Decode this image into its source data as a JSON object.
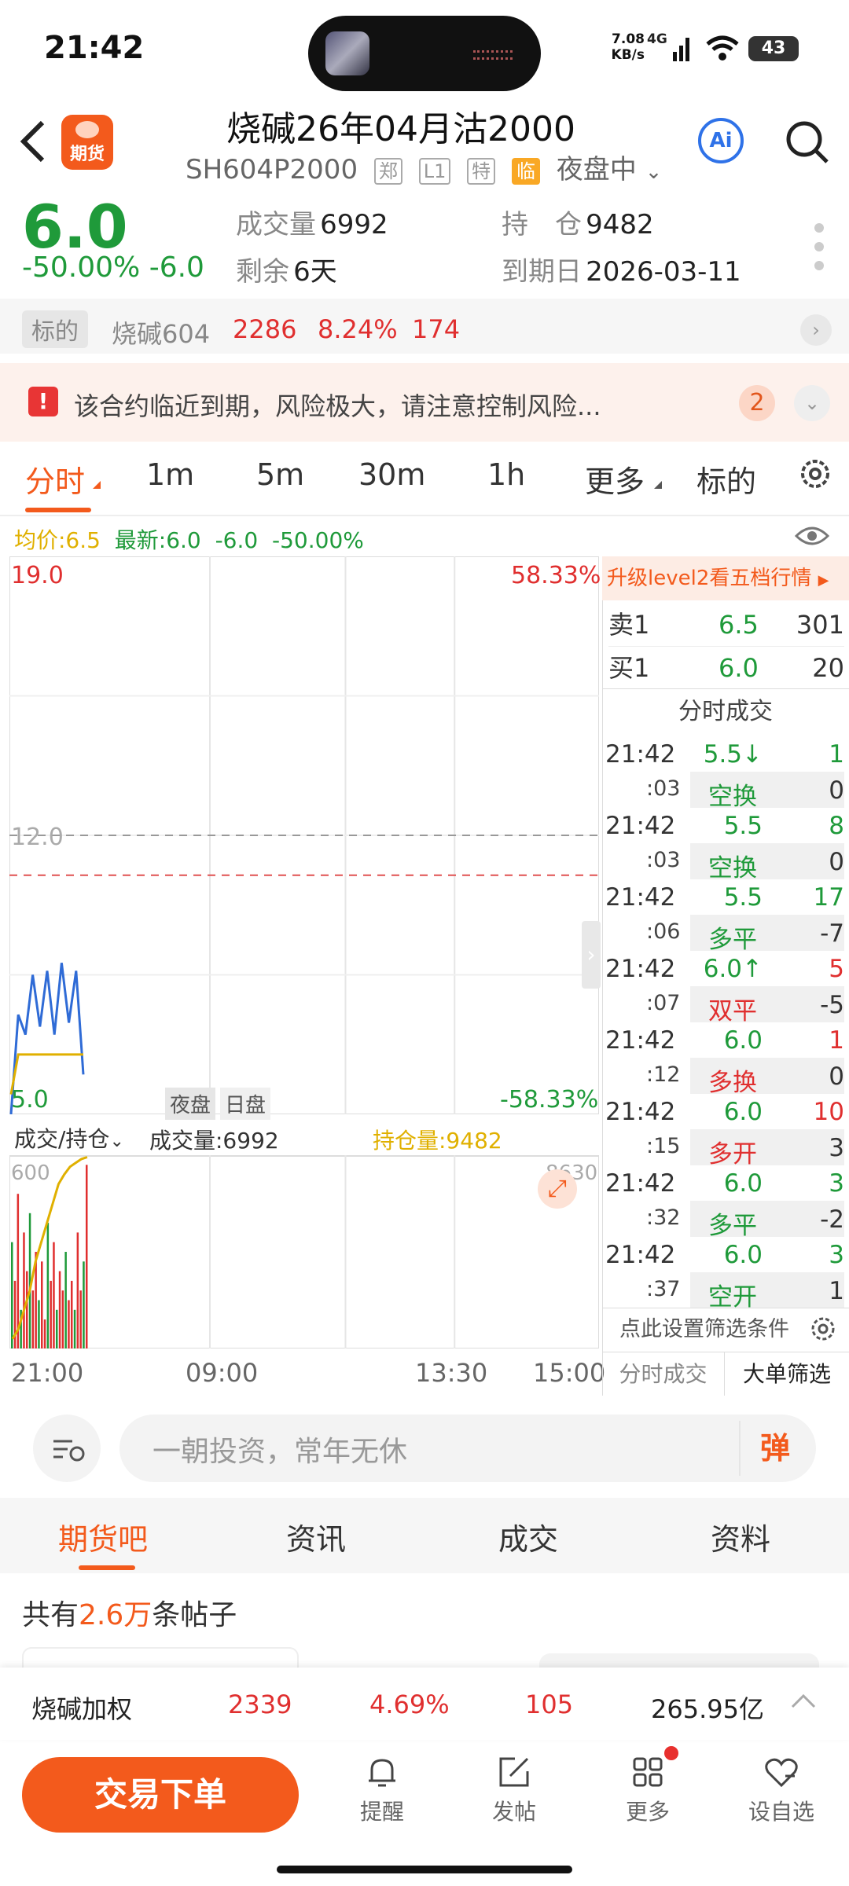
{
  "status": {
    "time": "21:42",
    "speed": "7.08 KB/s",
    "net": "4G",
    "battery": "43"
  },
  "header": {
    "title": "烧碱26年04月沽2000",
    "code": "SH604P2000",
    "tags": [
      "郑",
      "L1",
      "特"
    ],
    "tag_orange": "临",
    "session": "夜盘中",
    "ai_label": "Ai"
  },
  "quote": {
    "price": "6.0",
    "change": "-50.00% -6.0",
    "volume_label": "成交量",
    "volume": "6992",
    "remain_label": "剩余",
    "remain": "6天",
    "oi_label": "持　仓",
    "oi": "9482",
    "expiry_label": "到期日",
    "expiry": "2026-03-11"
  },
  "underlying": {
    "tag": "标的",
    "name": "烧碱604",
    "price": "2286",
    "pct": "8.24%",
    "change": "174"
  },
  "risk": {
    "icon": "!",
    "text": "该合约临近到期，风险极大，请注意控制风险...",
    "count": "2"
  },
  "period_tabs": [
    "分时",
    "1m",
    "5m",
    "30m",
    "1h",
    "更多",
    "标的"
  ],
  "legend": {
    "avg": "均价:6.5",
    "last": "最新:6.0",
    "chg": "-6.0",
    "pct": "-50.00%"
  },
  "chart": {
    "high": "19.0",
    "high_pct": "58.33%",
    "mid": "12.0",
    "low": "5.0",
    "low_pct": "-58.33%",
    "night": "夜盘",
    "day": "日盘",
    "vol_selector": "成交/持仓",
    "vol_text": "成交量:6992",
    "oi_text": "持仓量:9482",
    "vol_max": "600",
    "oi_max": "8630",
    "times": [
      "21:00",
      "09:00",
      "13:30",
      "15:00"
    ]
  },
  "chart_data": {
    "type": "line",
    "title": "",
    "ylim": [
      5.0,
      19.0
    ],
    "reference_price": 12.0,
    "series": [
      {
        "name": "最新",
        "values": [
          5.0,
          7.5,
          7.0,
          8.5,
          7.2,
          8.6,
          7.0,
          8.8,
          7.3,
          8.6,
          6.0
        ]
      },
      {
        "name": "均价",
        "values": [
          5.5,
          6.5,
          6.5,
          6.5,
          6.5,
          6.5,
          6.5,
          6.5,
          6.5,
          6.5,
          6.5
        ]
      }
    ],
    "volume_max": 600,
    "oi_max": 8630
  },
  "orderbook": {
    "upgrade": "升级level2看五档行情",
    "ask_label": "卖1",
    "ask_price": "6.5",
    "ask_qty": "301",
    "bid_label": "买1",
    "bid_price": "6.0",
    "bid_qty": "20",
    "ticks_title": "分时成交"
  },
  "ticks": [
    {
      "time": "21:42",
      "price": "5.5↓",
      "qty": "1",
      "sec": ":03",
      "type": "空换",
      "oi": "0",
      "pc": "green",
      "qc": "green",
      "tc": "green"
    },
    {
      "time": "21:42",
      "price": "5.5",
      "qty": "8",
      "sec": ":03",
      "type": "空换",
      "oi": "0",
      "pc": "green",
      "qc": "green",
      "tc": "green"
    },
    {
      "time": "21:42",
      "price": "5.5",
      "qty": "17",
      "sec": ":06",
      "type": "多平",
      "oi": "-7",
      "pc": "green",
      "qc": "green",
      "tc": "green"
    },
    {
      "time": "21:42",
      "price": "6.0↑",
      "qty": "5",
      "sec": ":07",
      "type": "双平",
      "oi": "-5",
      "pc": "green",
      "qc": "red",
      "tc": "red"
    },
    {
      "time": "21:42",
      "price": "6.0",
      "qty": "1",
      "sec": ":12",
      "type": "多换",
      "oi": "0",
      "pc": "green",
      "qc": "red",
      "tc": "red"
    },
    {
      "time": "21:42",
      "price": "6.0",
      "qty": "10",
      "sec": ":15",
      "type": "多开",
      "oi": "3",
      "pc": "green",
      "qc": "red",
      "tc": "red"
    },
    {
      "time": "21:42",
      "price": "6.0",
      "qty": "3",
      "sec": ":32",
      "type": "多平",
      "oi": "-2",
      "pc": "green",
      "qc": "green",
      "tc": "green"
    },
    {
      "time": "21:42",
      "price": "6.0",
      "qty": "3",
      "sec": ":37",
      "type": "空开",
      "oi": "1",
      "pc": "green",
      "qc": "green",
      "tc": "green"
    }
  ],
  "filter": {
    "cond": "点此设置筛选条件",
    "tab1": "分时成交",
    "tab2": "大单筛选"
  },
  "input": {
    "placeholder": "一朝投资，常年无休",
    "danmu": "弹"
  },
  "bottom_tabs": [
    "期货吧",
    "资讯",
    "成交",
    "资料"
  ],
  "posts": {
    "prefix": "共有",
    "count": "2.6万",
    "suffix": "条帖子"
  },
  "weighted": {
    "name": "烧碱加权",
    "price": "2339",
    "pct": "4.69%",
    "change": "105",
    "amount": "265.95亿"
  },
  "nav": {
    "trade": "交易下单",
    "alert": "提醒",
    "post": "发帖",
    "more": "更多",
    "watch": "设自选"
  },
  "colors": {
    "accent": "#f35a1c",
    "up": "#e02f2f",
    "down": "#1f9a3a",
    "avg": "#e0b000",
    "line": "#2f6bd6"
  }
}
